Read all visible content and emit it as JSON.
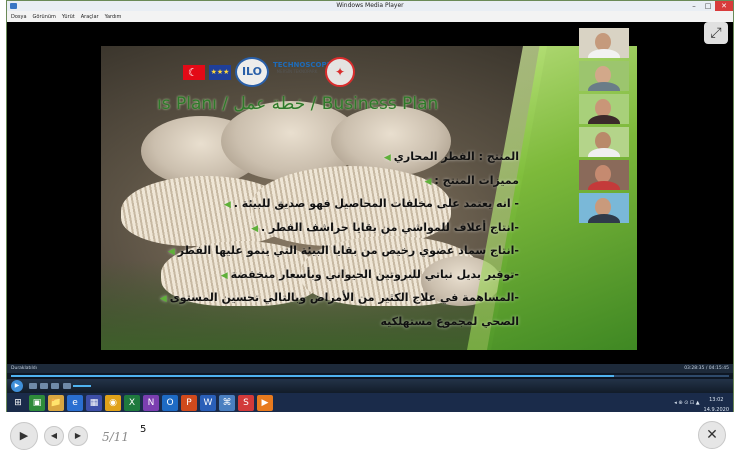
{
  "wmp": {
    "title": "Windows Media Player",
    "menu": [
      "Dosya",
      "Görünüm",
      "Yürüt",
      "Araçlar",
      "Yardım"
    ],
    "window_buttons": {
      "minimize": "–",
      "maximize": "□",
      "close": "✕"
    }
  },
  "slide": {
    "title": "ıs Planı / خطة عمل / Business Plan",
    "logos": {
      "eu_flag": "★★★",
      "ilo": "ILO",
      "techno": "TECHNOSCOPE",
      "techno_sub": "MERSİN TEKNOPARK",
      "seal": "✦"
    },
    "bullets": [
      "المنتج : الفطر المحاري",
      "مميزات المنتج :",
      "- انه يعتمد على مخلفات المحاصيل فهو صديق للبيئة .",
      "-انتاج أعلاف للمواشي من بقايا حراشف الفطر .",
      "-انتاج سماد عضوي رخيص من بقايا البيئة التي ينمو عليها الفطر",
      "-توفير بديل نباتي للبروتين الحيواني وبأسعار منخفضة",
      "-المساهمة في علاج الكثير من الأمراض وبالتالي تحسين المستوى",
      "الصحي لمجموع مستهلكيه"
    ],
    "bullet_marker": "◀"
  },
  "participants_count_label": "",
  "expand_icon_glyph": "⤢",
  "status": {
    "left": "Duraklatıldı",
    "right": "03:28:35 / 04:15:45"
  },
  "seek": {
    "progress_fraction": 0.84
  },
  "taskbar": {
    "icons": [
      "⊞",
      "▣",
      "📁",
      "e",
      "▦",
      "◉",
      "X",
      "N",
      "O",
      "P",
      "W",
      "⌘",
      "S",
      "▶"
    ],
    "icon_colors": [
      "#1a2b4a",
      "#2e8b3a",
      "#d9a640",
      "#2a6fd1",
      "#3e4fa8",
      "#e0a21a",
      "#1f7a3e",
      "#7b3fb0",
      "#1e6bc4",
      "#d04a1c",
      "#2a5fb8",
      "#4a7fc0",
      "#d23a3a",
      "#e87a1e"
    ],
    "tray": "◂ ⊕ ⊙ ⊡ ▲",
    "clock_time": "13:02",
    "clock_date": "14.9.2020"
  },
  "viewer": {
    "play": "▶",
    "prev": "◀",
    "next": "▶",
    "pager": "5/11",
    "slide_number": "5",
    "close": "✕"
  }
}
